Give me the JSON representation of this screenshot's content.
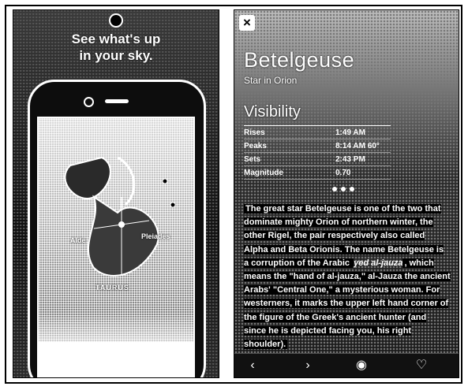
{
  "left_panel": {
    "headline_line1": "See what's up",
    "headline_line2_prefix": "in ",
    "headline_line2_em": "your",
    "headline_line2_suffix": " sky.",
    "labels": {
      "left": "Alde",
      "right": "Pleiades",
      "constellation": "TAURUS"
    }
  },
  "right_panel": {
    "close_icon": "close-icon",
    "title": "Betelgeuse",
    "subtitle": "Star in Orion",
    "visibility": {
      "heading": "Visibility",
      "rows": [
        {
          "key": "Rises",
          "value": "1:49 AM"
        },
        {
          "key": "Peaks",
          "value": "8:14 AM 60°"
        },
        {
          "key": "Sets",
          "value": "2:43 PM"
        },
        {
          "key": "Magnitude",
          "value": "0.70"
        }
      ]
    },
    "page_dots": 3,
    "description_parts": {
      "p1": "The great star Betelgeuse is one of the two that dominate mighty Orion of northern winter, the other Rigel, the pair respectively also called Alpha and Beta Orionis. The name Betelgeuse is a corruption of the Arabic ",
      "italic1": "yed al-jauza",
      "p2": ", which means the \"hand of al-jauza,\" al-Jauza the ancient Arabs' \"Central One,\" a mysterious woman. For westerners, it marks the upper left hand corner of the figure of the Greek's ancient hunter (and since he is depicted facing you, his right shoulder)."
    },
    "bottom_bar": [
      "chevron-left-icon",
      "chevron-right-icon",
      "target-icon",
      "heart-icon"
    ],
    "bottom_glyphs": {
      "back": "‹",
      "forward": "›",
      "target": "◉",
      "heart": "♡"
    }
  }
}
